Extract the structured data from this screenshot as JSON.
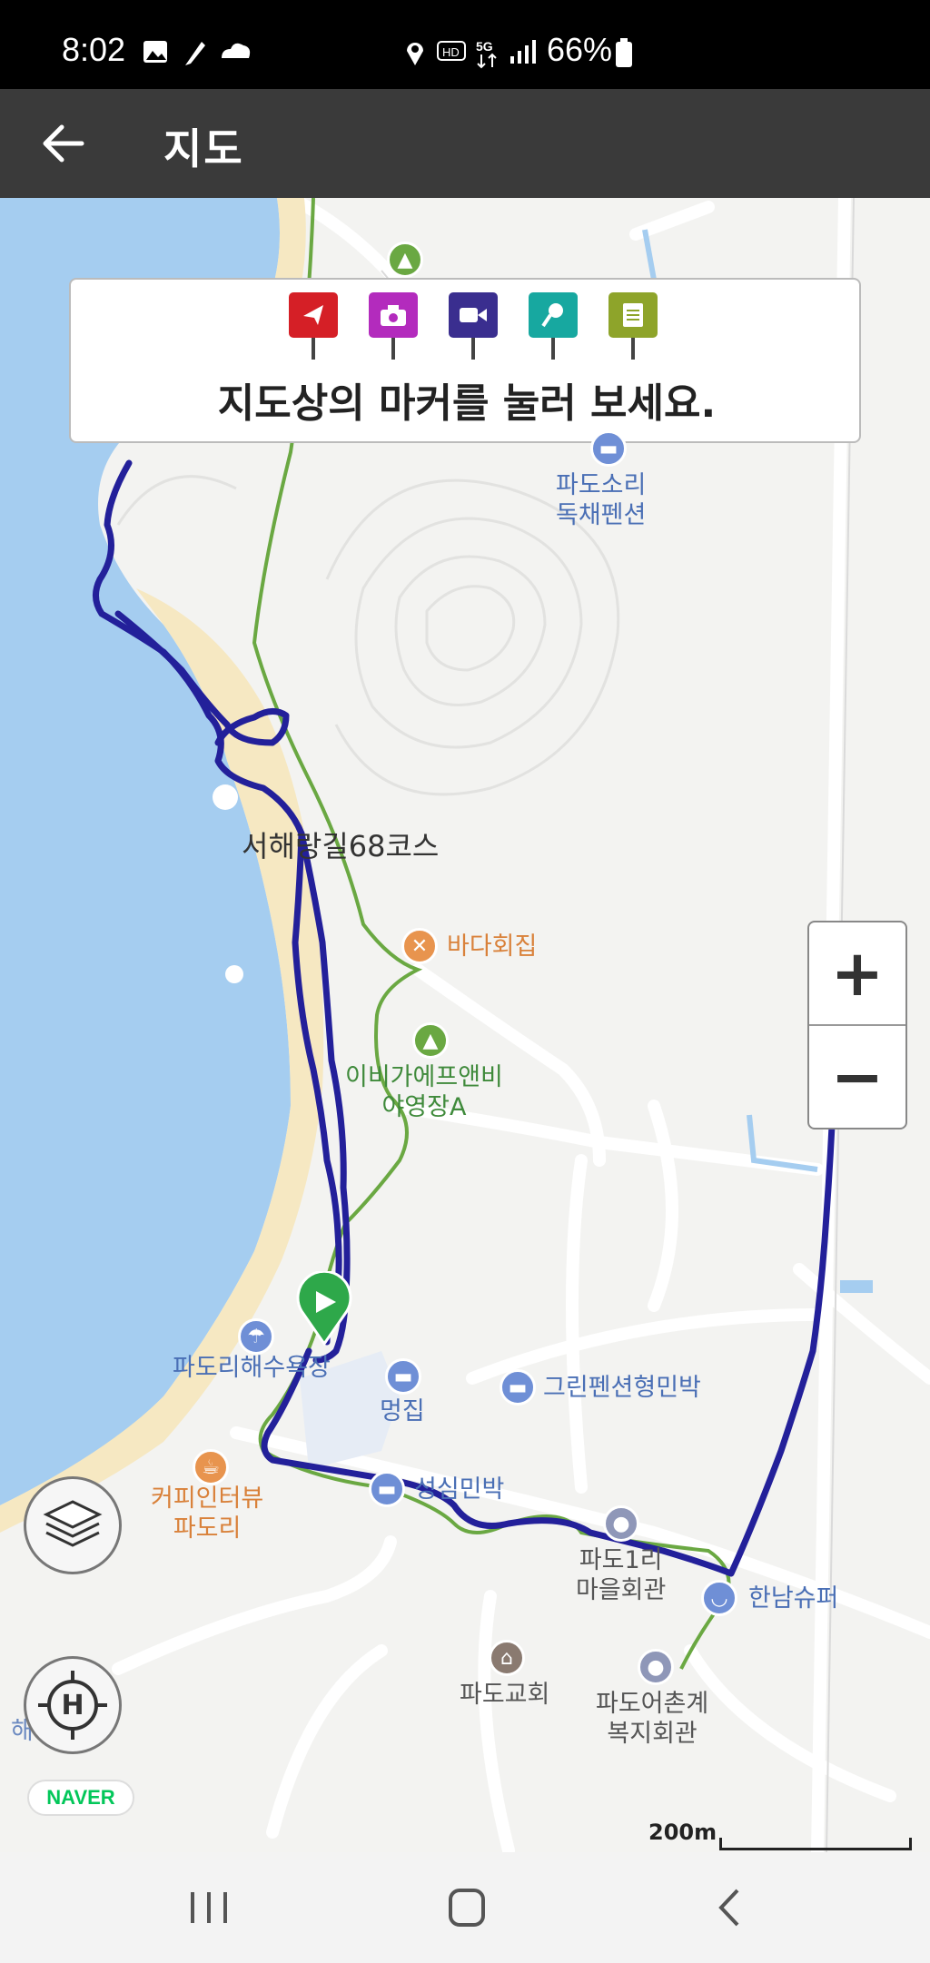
{
  "status_bar": {
    "time": "8:02",
    "battery": "66%"
  },
  "app_bar": {
    "title": "지도"
  },
  "banner": {
    "hint": "지도상의 마커를 눌러 보세요.",
    "markers": [
      {
        "icon": "flag-icon",
        "color": "#d51f26"
      },
      {
        "icon": "camera-icon",
        "color": "#b32bbd"
      },
      {
        "icon": "video-icon",
        "color": "#3a2e8f"
      },
      {
        "icon": "microphone-icon",
        "color": "#17a8a0"
      },
      {
        "icon": "memo-icon",
        "color": "#8ea42a"
      }
    ]
  },
  "map": {
    "route_label": "서해랑길68코스",
    "places": {
      "pension_1": "파도소리",
      "pension_2": "독채펜션",
      "restaurant": "바다회집",
      "camp_1": "이비가에프앤비",
      "camp_2": "야영장A",
      "beach": "파도리해수욕장",
      "meongjip": "멍집",
      "green_pension": "그린펜션형민박",
      "cafe_1": "커피인터뷰",
      "cafe_2": "파도리",
      "seongsim": "성심민박",
      "hall_1": "파도1리",
      "hall_2": "마을회관",
      "supermarket": "한남슈퍼",
      "church": "파도교회",
      "welfare_1": "파도어촌계",
      "welfare_2": "복지회관",
      "beach_edge": "해변"
    },
    "route_color": "#23209a",
    "trail_color": "#6aa842",
    "sea_color": "#a5cdf0",
    "sand_color": "#f6e8c2"
  },
  "controls": {
    "zoom_in": "+",
    "zoom_out": "−",
    "compass": "H",
    "naver": "NAVER",
    "scale": "200m"
  }
}
